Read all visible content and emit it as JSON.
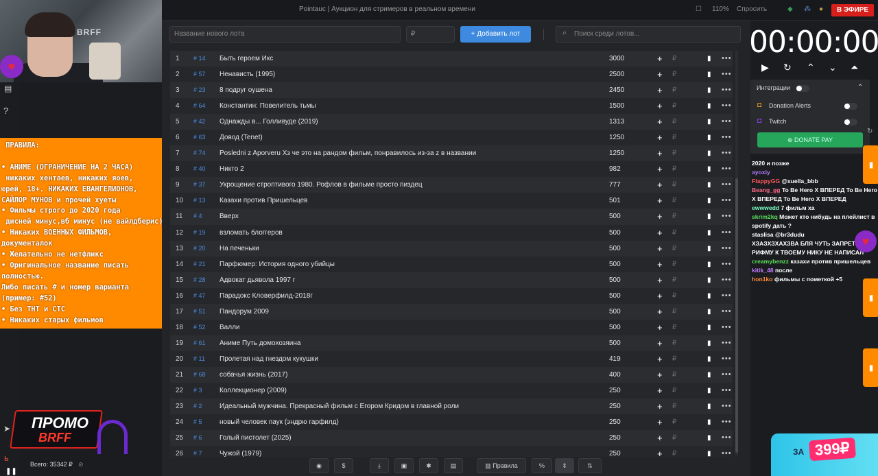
{
  "window": {
    "title": "Pointauc | Аукцион для стримеров в реальном времени",
    "zoom": "110%",
    "reply_label": "Спросить",
    "live_badge": "В ЭФИРЕ"
  },
  "stream_overlay": {
    "rules_text": " ПРАВИЛА:\n\n• АНИМЕ (ОГРАНИЧЕНИЕ НА 2 ЧАСА)\n никаких хентаев, никаких яоев,\nюрей, 18+. НИКАКИХ ЕВАНГЕЛИОНОВ,\nСАЙЛОР МУНОВ и прочей хуеты\n• Фильмы строго до 2020 года\n дисней минус,вб минус (не вайлдберис)\n• Никаких ВОЕННЫХ ФИЛЬМОВ,\nдокументалок\n• Желательно не нетфликс\n• Оригинальное название писать\nполностью.\nЛибо писать # и номер варианта\n(пример: #52)\n• Без ТНТ и СТС\n• Никаких старых фильмов",
    "promo_line1": "ПРОМО",
    "promo_line2": "BRFF",
    "webcam_watermark": "BRFF"
  },
  "toolbar": {
    "lot_name_placeholder": "Название нового лота",
    "amount_placeholder": "₽",
    "add_button": "Добавить лот",
    "search_placeholder": "Поиск среди лотов..."
  },
  "lots": [
    {
      "n": "1",
      "id": "# 14",
      "name": "Быть героем Икс",
      "amount": "3000"
    },
    {
      "n": "2",
      "id": "# 57",
      "name": "Ненависть (1995)",
      "amount": "2500"
    },
    {
      "n": "3",
      "id": "# 23",
      "name": "8 подруг оушена",
      "amount": "2450"
    },
    {
      "n": "4",
      "id": "# 64",
      "name": "Константин: Повелитель тьмы",
      "amount": "1500"
    },
    {
      "n": "5",
      "id": "# 42",
      "name": "Однажды в... Голливуде (2019)",
      "amount": "1313"
    },
    {
      "n": "6",
      "id": "# 63",
      "name": "Довод (Tenet)",
      "amount": "1250"
    },
    {
      "n": "7",
      "id": "# 74",
      "name": "Posledni z Aporveru Хз че это на рандом фильм, понравилось из-за z в названии",
      "amount": "1250"
    },
    {
      "n": "8",
      "id": "# 40",
      "name": "Никто 2",
      "amount": "982"
    },
    {
      "n": "9",
      "id": "# 37",
      "name": "Укрощение строптивого 1980. Рофлов в фильме просто пиздец",
      "amount": "777"
    },
    {
      "n": "10",
      "id": "# 13",
      "name": "Казахи против Пришельцев",
      "amount": "501"
    },
    {
      "n": "11",
      "id": "# 4",
      "name": "Вверх",
      "amount": "500"
    },
    {
      "n": "12",
      "id": "# 19",
      "name": "взломать блоггеров",
      "amount": "500"
    },
    {
      "n": "13",
      "id": "# 20",
      "name": "На печеньки",
      "amount": "500"
    },
    {
      "n": "14",
      "id": "# 21",
      "name": "Парфюмер: История одного убийцы",
      "amount": "500"
    },
    {
      "n": "15",
      "id": "# 28",
      "name": "Адвокат дьявола 1997 г",
      "amount": "500"
    },
    {
      "n": "16",
      "id": "# 47",
      "name": "Парадокс Кловерфилд-2018г",
      "amount": "500"
    },
    {
      "n": "17",
      "id": "# 51",
      "name": "Пандорум 2009",
      "amount": "500"
    },
    {
      "n": "18",
      "id": "# 52",
      "name": "Валли",
      "amount": "500"
    },
    {
      "n": "19",
      "id": "# 61",
      "name": "Аниме Путь домохозяина",
      "amount": "500"
    },
    {
      "n": "20",
      "id": "# 11",
      "name": "Пролетая над гнездом кукушки",
      "amount": "419"
    },
    {
      "n": "21",
      "id": "# 68",
      "name": "собачья жизнь (2017)",
      "amount": "400"
    },
    {
      "n": "22",
      "id": "# 3",
      "name": "Коллекционер (2009)",
      "amount": "250"
    },
    {
      "n": "23",
      "id": "# 2",
      "name": "Идеальный мужчина. Прекрасный фильм с Егором Кридом в главной роли",
      "amount": "250"
    },
    {
      "n": "24",
      "id": "# 5",
      "name": "новый человек паук (эндрю гарфилд)",
      "amount": "250"
    },
    {
      "n": "25",
      "id": "# 6",
      "name": "Голый пистолет (2025)",
      "amount": "250"
    },
    {
      "n": "26",
      "id": "# 7",
      "name": "Чужой (1979)",
      "amount": "250"
    }
  ],
  "footer": {
    "total": "Всего: 35342 ₽",
    "rules_button": "Правила",
    "percent_button": "%",
    "dollar_button": "$"
  },
  "timer": {
    "value": "00:00:00"
  },
  "integrations": {
    "title": "Интеграции",
    "donation_alerts": "Donation Alerts",
    "twitch": "Twitch",
    "donate_pay": "DONATE PAY"
  },
  "chat": [
    {
      "nick": "",
      "color": "#ffffff",
      "text": "2020 и позже"
    },
    {
      "nick": "ayoxiy",
      "color": "#b57bff",
      "text": ""
    },
    {
      "nick": "FlappyGG",
      "color": "#ff5a5a",
      "text": "@xuella_bbb"
    },
    {
      "nick": "Beang_gg",
      "color": "#ff6a8a",
      "text": "To Be Hero X ВПЕРЕД To Be Hero X ВПЕРЕД To Be Hero X ВПЕРЕД"
    },
    {
      "nick": "ewwwedd",
      "color": "#7affc7",
      "text": "7 фильм ха"
    },
    {
      "nick": "skrim2kq",
      "color": "#5ae05a",
      "text": "Может кто нибудь на плейлист в spotify дать ?"
    },
    {
      "nick": "staslisa",
      "color": "#ffffff",
      "text": "@br3dudu"
    },
    {
      "nick": "",
      "color": "#ffffff",
      "text": "ХЗАЗХЗХАХЗВА БЛЯ ЧУТЬ ЗАПРЕТКУ В РИФМУ К ТВОЕМУ НИКУ НЕ НАПИСАЛ"
    },
    {
      "nick": "creamybenzz",
      "color": "#5ae05a",
      "text": "казахи против пришельцев"
    },
    {
      "nick": "kitik_48",
      "color": "#c07bff",
      "text": "после"
    },
    {
      "nick": "hon1ko",
      "color": "#ff8a3a",
      "text": "фильмы с пометкой +5"
    }
  ],
  "ad": {
    "price": "399₽",
    "prefix": "ЗА"
  }
}
